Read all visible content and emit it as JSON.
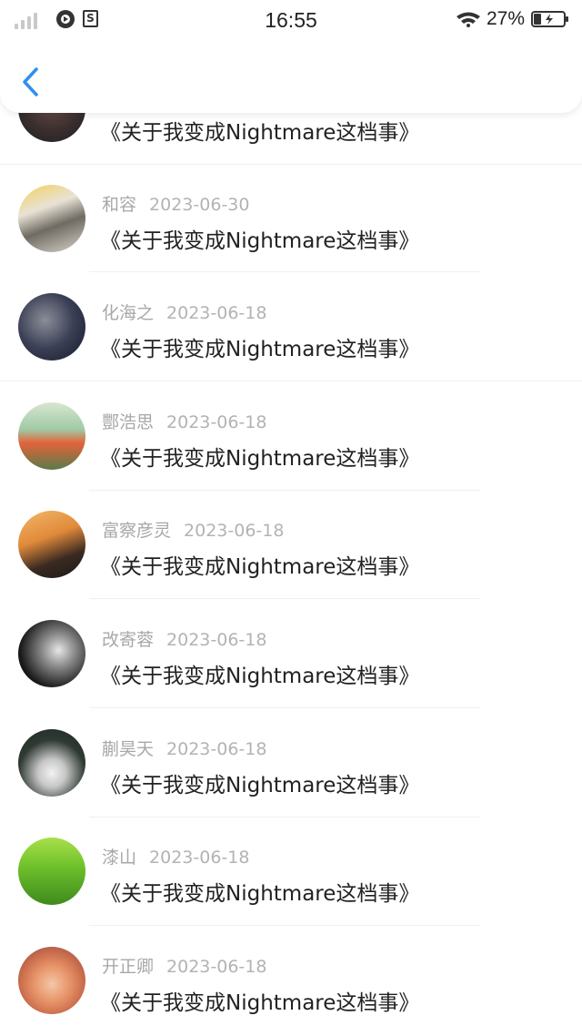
{
  "status_bar": {
    "time": "16:55",
    "battery_percent": "27%",
    "app_badge_letter": "S"
  },
  "header": {
    "back_icon": "chevron-left-icon",
    "accent_color": "#2f8ff0"
  },
  "list": {
    "partial_top_title": "《关于我变成Nightmare这档事》",
    "items": [
      {
        "name": "和容",
        "date": "2023-06-30",
        "title": "《关于我变成Nightmare这档事》"
      },
      {
        "name": "化海之",
        "date": "2023-06-18",
        "title": "《关于我变成Nightmare这档事》"
      },
      {
        "name": "酆浩思",
        "date": "2023-06-18",
        "title": "《关于我变成Nightmare这档事》"
      },
      {
        "name": "富察彦灵",
        "date": "2023-06-18",
        "title": "《关于我变成Nightmare这档事》"
      },
      {
        "name": "改寄蓉",
        "date": "2023-06-18",
        "title": "《关于我变成Nightmare这档事》"
      },
      {
        "name": "蒯昊天",
        "date": "2023-06-18",
        "title": "《关于我变成Nightmare这档事》"
      },
      {
        "name": "漆山",
        "date": "2023-06-18",
        "title": "《关于我变成Nightmare这档事》"
      },
      {
        "name": "开正卿",
        "date": "2023-06-18",
        "title": "《关于我变成Nightmare这档事》"
      }
    ]
  }
}
